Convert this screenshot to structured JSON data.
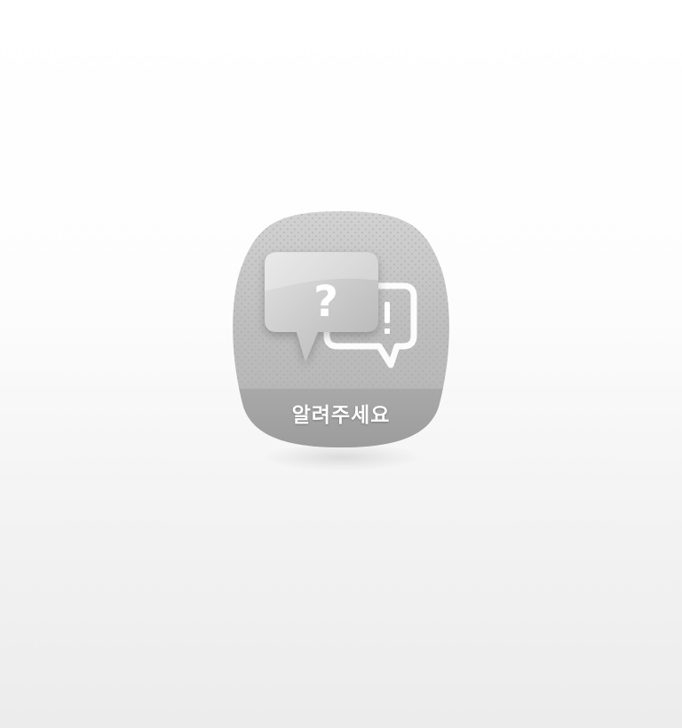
{
  "icon": {
    "label": "알려주세요",
    "name": "question-answer-speech-bubble-icon",
    "question_glyph": "?",
    "exclamation_glyph": "!",
    "colors": {
      "body": "#b9b9b9",
      "band": "#a7a7a7",
      "bubble": "#c7c7c7",
      "glyph": "#ffffff"
    }
  }
}
